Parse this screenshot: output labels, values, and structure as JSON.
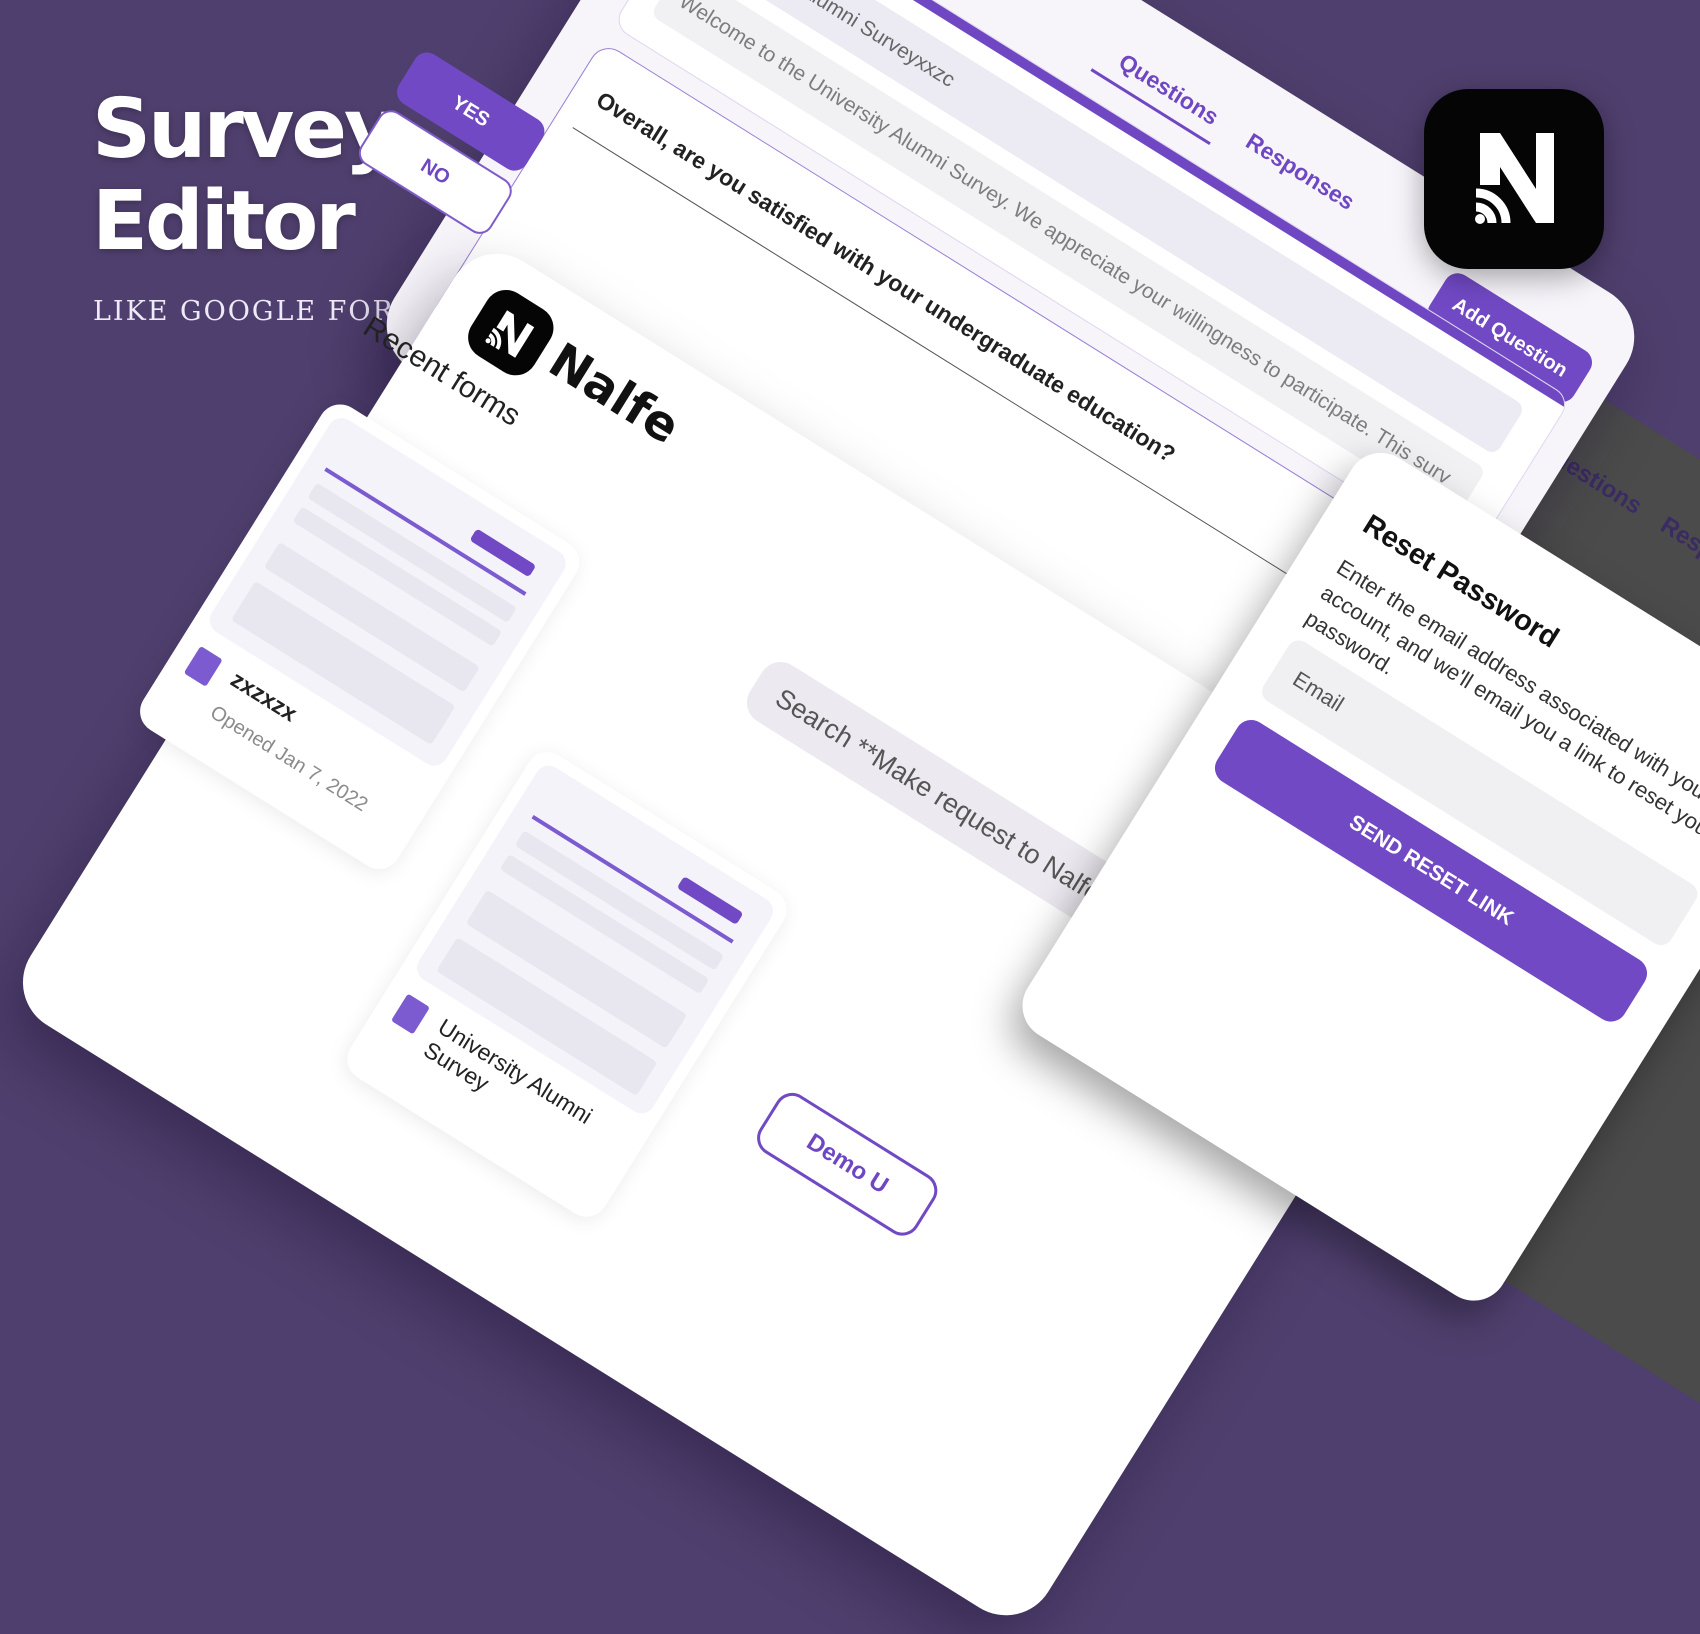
{
  "hero": {
    "title_line1": "Survey",
    "title_line2": "Editor",
    "subtitle": "LIKE GOOGLE FORM"
  },
  "brand": {
    "logo_icon": "nalfe-n-logo-icon",
    "name": "Nalfe"
  },
  "survey_editor": {
    "tabs": {
      "questions": "Questions",
      "responses": "Responses"
    },
    "add_question": "Add Question",
    "title_value": "University Alumni Surveyxxzc",
    "description_value": "Welcome to the University Alumni Survey. We appreciate your willingness to participate. This surv",
    "question_text": "Overall, are you satisfied with your undergraduate education?",
    "options": {
      "yes": "YES",
      "no": "NO"
    }
  },
  "recent_forms": {
    "title": "Recent forms",
    "search_placeholder": "Search **Make request to Nalfe for",
    "forms": [
      {
        "name": "zxzxzx",
        "opened": "Opened Jan 7, 2022"
      }
    ],
    "second_form_title": "University Alumni Survey",
    "demo_button": "Demo U"
  },
  "reset_password": {
    "title": "Reset Password",
    "description": "Enter the email address associated with your account, and we'll email you a link to reset your password.",
    "email_placeholder": "Email",
    "submit_label": "SEND RESET LINK"
  },
  "colors": {
    "background": "#4f3f6e",
    "accent": "#7149c4",
    "logo_bg": "#050505"
  }
}
